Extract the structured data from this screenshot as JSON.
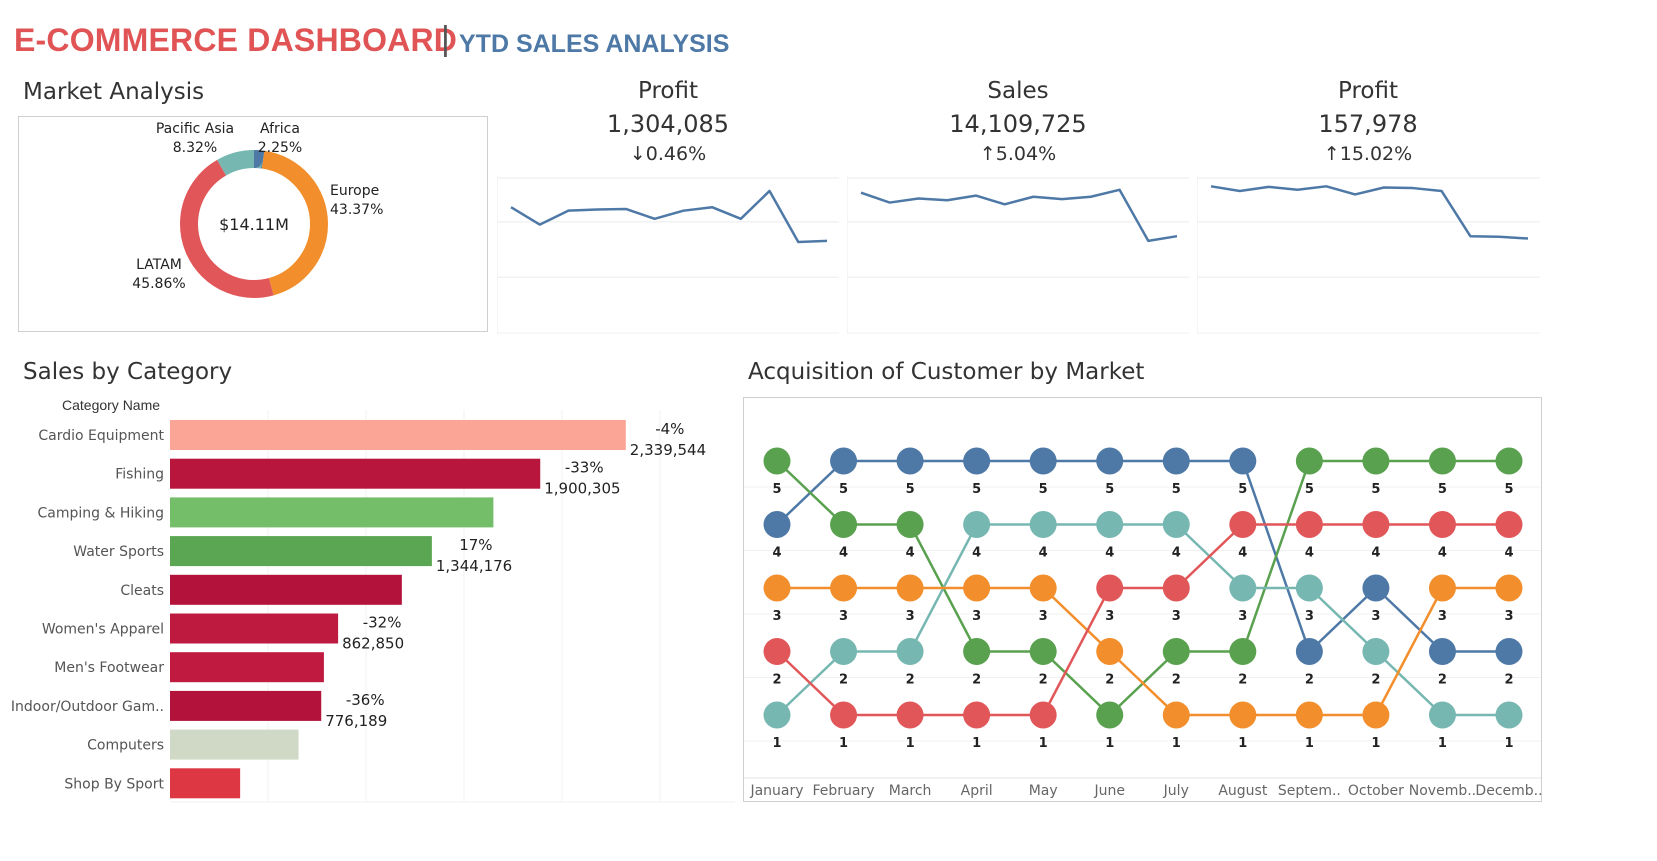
{
  "header": {
    "title": "E-COMMERCE DASHBOARD",
    "separator": "|",
    "subtitle": "YTD SALES ANALYSIS"
  },
  "colors": {
    "title_red": "#e05456",
    "subtitle_blue": "#4e79a7",
    "line_blue": "#4e79a7"
  },
  "market_analysis": {
    "title": "Market Analysis",
    "center_label": "$14.11M",
    "slices": [
      {
        "name": "Europe",
        "pct_label": "43.37%",
        "value": 43.37,
        "color": "#f28e2b"
      },
      {
        "name": "LATAM",
        "pct_label": "45.86%",
        "value": 45.86,
        "color": "#e15759"
      },
      {
        "name": "Pacific Asia",
        "pct_label": "8.32%",
        "value": 8.32,
        "color": "#76b7b2"
      },
      {
        "name": "Africa",
        "pct_label": "2.25%",
        "value": 2.25,
        "color": "#4e79a7"
      }
    ]
  },
  "kpis": [
    {
      "label": "Profit",
      "value": "1,304,085",
      "change": "↓0.46%",
      "trend": [
        0.4,
        0.7,
        0.46,
        0.44,
        0.43,
        0.6,
        0.46,
        0.4,
        0.6,
        0.12,
        1.0,
        0.98
      ]
    },
    {
      "label": "Sales",
      "value": "14,109,725",
      "change": "↑5.04%",
      "trend": [
        0.15,
        0.32,
        0.25,
        0.28,
        0.2,
        0.35,
        0.22,
        0.26,
        0.22,
        0.1,
        0.98,
        0.9
      ]
    },
    {
      "label": "Profit",
      "value": "157,978",
      "change": "↑15.02%",
      "trend": [
        0.04,
        0.12,
        0.05,
        0.1,
        0.04,
        0.18,
        0.06,
        0.07,
        0.12,
        0.9,
        0.91,
        0.94
      ]
    }
  ],
  "sales_by_category": {
    "title": "Sales by Category",
    "column_header": "Category Name",
    "chart_data": {
      "type": "bar",
      "categories": [
        "Cardio Equipment",
        "Fishing",
        "Camping & Hiking",
        "Water Sports",
        "Cleats",
        "Women's Apparel",
        "Men's Footwear",
        "Indoor/Outdoor Gam..",
        "Computers",
        "Shop By Sport"
      ],
      "values": [
        2339544,
        1900305,
        1660000,
        1344176,
        1190000,
        862850,
        790000,
        776189,
        660000,
        360000
      ],
      "colors": [
        "#fba597",
        "#b9163d",
        "#74be6a",
        "#5aa653",
        "#b3123a",
        "#be1a40",
        "#c01a41",
        "#b3123a",
        "#d0d8c6",
        "#dd3744"
      ],
      "value_labels": [
        "2,339,544",
        "1,900,305",
        "",
        "1,344,176",
        "",
        "862,850",
        "",
        "776,189",
        "",
        ""
      ],
      "change_labels": [
        "-4%",
        "-33%",
        "",
        "17%",
        "",
        "-32%",
        "",
        "-36%",
        "",
        ""
      ],
      "xlim": [
        0,
        2900000
      ]
    }
  },
  "acquisition": {
    "title": "Acquisition of Customer by Market",
    "chart_data": {
      "type": "line",
      "x": [
        "January",
        "February",
        "March",
        "April",
        "May",
        "June",
        "July",
        "August",
        "Septem..",
        "October",
        "Novemb..",
        "Decemb.."
      ],
      "ylim": [
        1,
        5
      ],
      "series": [
        {
          "color": "#4e79a7",
          "values": [
            4,
            5,
            5,
            5,
            5,
            5,
            5,
            5,
            2,
            3,
            2,
            2
          ]
        },
        {
          "color": "#59a14f",
          "values": [
            5,
            4,
            4,
            2,
            2,
            1,
            2,
            2,
            5,
            5,
            5,
            5
          ]
        },
        {
          "color": "#76b7b2",
          "values": [
            1,
            2,
            2,
            4,
            4,
            4,
            4,
            3,
            3,
            2,
            1,
            1
          ]
        },
        {
          "color": "#f28e2b",
          "values": [
            3,
            3,
            3,
            3,
            3,
            2,
            1,
            1,
            1,
            1,
            3,
            3
          ]
        },
        {
          "color": "#e15759",
          "values": [
            2,
            1,
            1,
            1,
            1,
            3,
            3,
            4,
            4,
            4,
            4,
            4
          ]
        }
      ]
    }
  }
}
